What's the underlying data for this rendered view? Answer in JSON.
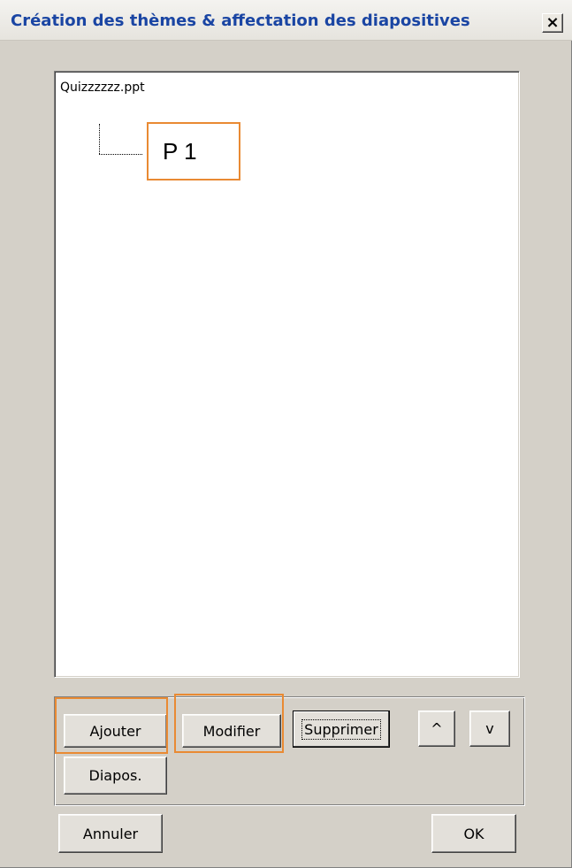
{
  "window": {
    "title": "Création des thèmes & affectation des diapositives",
    "close_label": "×"
  },
  "tree": {
    "root_label": "Quizzzzzz.ppt",
    "children": [
      {
        "label": "P 1",
        "highlighted": true
      }
    ]
  },
  "buttons": {
    "ajouter": "Ajouter",
    "modifier": "Modifier",
    "supprimer": "Supprimer",
    "up": "^",
    "down": "v",
    "diapos": "Diapos.",
    "annuler": "Annuler",
    "ok": "OK"
  },
  "annotations": {
    "highlight_color": "#e98a33"
  },
  "colors": {
    "title_text": "#1a45a3",
    "dialog_background": "#d4d0c8"
  }
}
